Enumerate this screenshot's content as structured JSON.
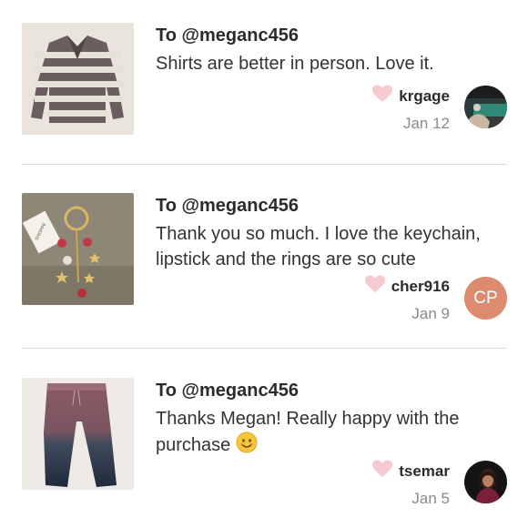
{
  "comments": [
    {
      "to": "To @meganc456",
      "message": "Shirts are better in person. Love it.",
      "username": "krgage",
      "date": "Jan 12",
      "listing_image": "striped-sweater",
      "avatar_type": "photo"
    },
    {
      "to": "To @meganc456",
      "message": "Thank you so much. I love the keychain, lipstick and the rings are so cute",
      "username": "cher916",
      "date": "Jan 9",
      "listing_image": "keychain",
      "avatar_type": "initials",
      "avatar_initials": "CP",
      "avatar_color": "#dc8b6e"
    },
    {
      "to": "To @meganc456",
      "message": "Thanks Megan! Really happy with the purchase",
      "emoji": "smiling-face-emoji",
      "username": "tsemar",
      "date": "Jan 5",
      "listing_image": "ombre-pants",
      "avatar_type": "photo"
    }
  ],
  "colors": {
    "heart": "#f7c9d0",
    "divider": "#dcdcdc",
    "date_text": "#8a8a8a"
  }
}
